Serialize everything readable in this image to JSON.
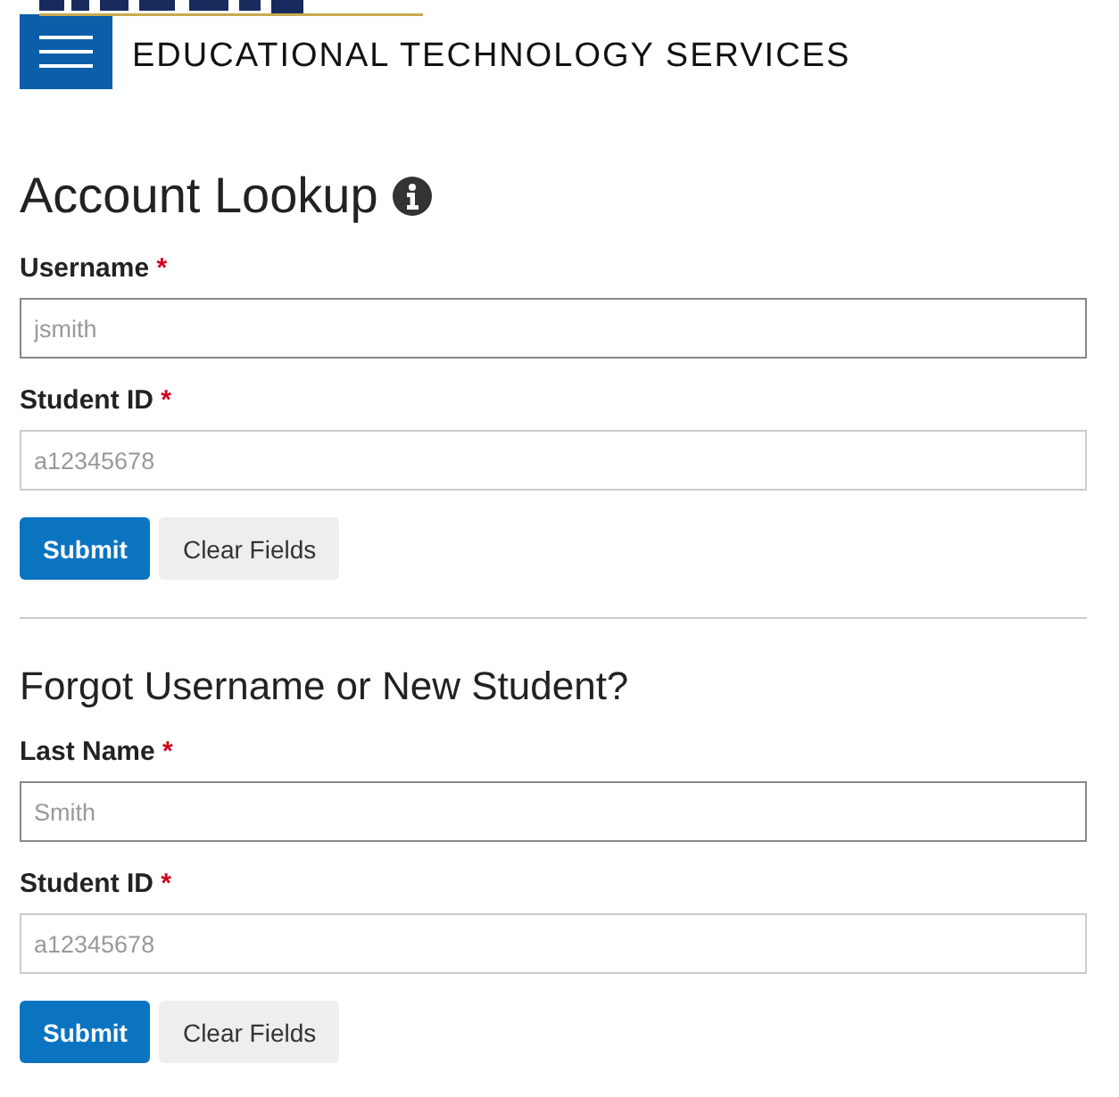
{
  "header": {
    "title": "EDUCATIONAL TECHNOLOGY SERVICES"
  },
  "sections": [
    {
      "heading": "Account Lookup",
      "info": true,
      "fields": [
        {
          "label": "Username",
          "required": true,
          "required_mark": "*",
          "placeholder": "jsmith",
          "focused": true
        },
        {
          "label": "Student ID",
          "required": true,
          "required_mark": "*",
          "placeholder": "a12345678",
          "focused": false
        }
      ],
      "buttons": [
        {
          "label": "Submit",
          "kind": "primary"
        },
        {
          "label": "Clear Fields",
          "kind": "secondary"
        }
      ]
    },
    {
      "heading": "Forgot Username or New Student?",
      "info": false,
      "fields": [
        {
          "label": "Last Name",
          "required": true,
          "required_mark": "*",
          "placeholder": "Smith",
          "focused": true
        },
        {
          "label": "Student ID",
          "required": true,
          "required_mark": "*",
          "placeholder": "a12345678",
          "focused": false
        }
      ],
      "buttons": [
        {
          "label": "Submit",
          "kind": "primary"
        },
        {
          "label": "Clear Fields",
          "kind": "secondary"
        }
      ]
    }
  ]
}
